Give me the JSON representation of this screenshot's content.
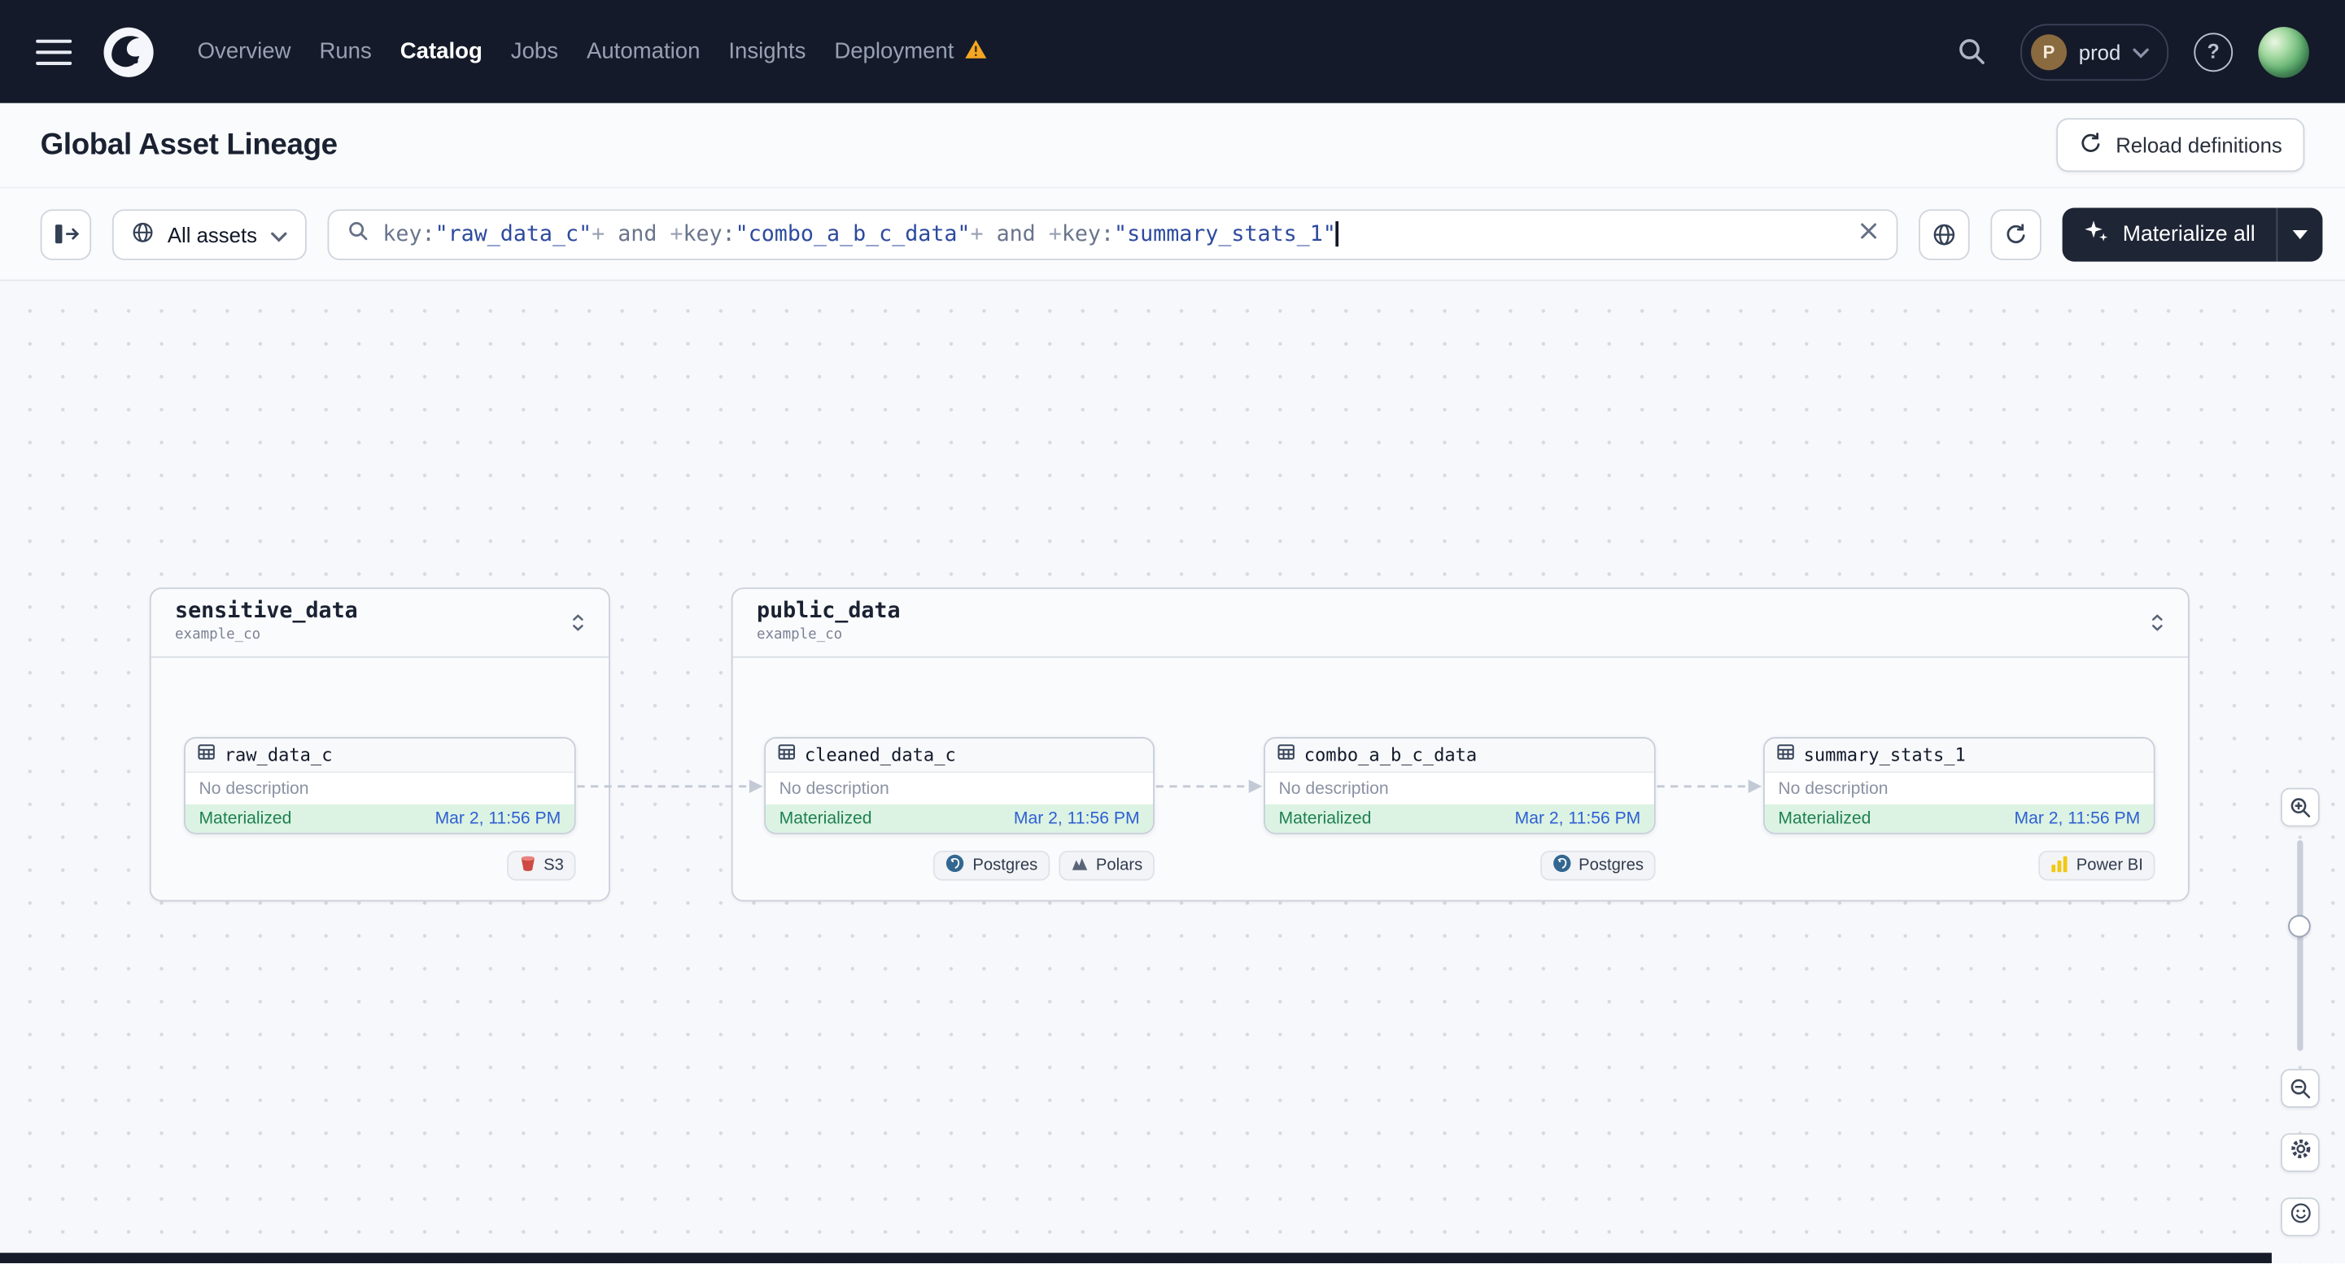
{
  "nav": {
    "items": [
      {
        "label": "Overview",
        "active": false
      },
      {
        "label": "Runs",
        "active": false
      },
      {
        "label": "Catalog",
        "active": true
      },
      {
        "label": "Jobs",
        "active": false
      },
      {
        "label": "Automation",
        "active": false
      },
      {
        "label": "Insights",
        "active": false
      },
      {
        "label": "Deployment",
        "active": false,
        "warning": true
      }
    ],
    "deployment_switcher": {
      "initial": "P",
      "label": "prod"
    },
    "help_glyph": "?"
  },
  "header": {
    "title": "Global Asset Lineage",
    "reload_button_label": "Reload definitions"
  },
  "toolbar": {
    "asset_filter_label": "All assets",
    "materialize_button_label": "Materialize all",
    "query_segments": [
      {
        "text": "key:",
        "type": "key"
      },
      {
        "text": "\"raw_data_c\"",
        "type": "value"
      },
      {
        "text": "+",
        "type": "plus"
      },
      {
        "text": " and ",
        "type": "keyword"
      },
      {
        "text": "+",
        "type": "plus"
      },
      {
        "text": "key:",
        "type": "key"
      },
      {
        "text": "\"combo_a_b_c_data\"",
        "type": "value"
      },
      {
        "text": "+",
        "type": "plus"
      },
      {
        "text": " and ",
        "type": "keyword"
      },
      {
        "text": "+",
        "type": "plus"
      },
      {
        "text": "key:",
        "type": "key"
      },
      {
        "text": "\"summary_stats_1\"",
        "type": "value"
      }
    ]
  },
  "graph": {
    "groups": [
      {
        "name": "sensitive_data",
        "org": "example_co",
        "assets": [
          {
            "name": "raw_data_c",
            "description": "No description",
            "status": "Materialized",
            "timestamp": "Mar 2, 11:56 PM",
            "tags": [
              {
                "label": "S3",
                "icon": "s3-icon"
              }
            ]
          }
        ]
      },
      {
        "name": "public_data",
        "org": "example_co",
        "assets": [
          {
            "name": "cleaned_data_c",
            "description": "No description",
            "status": "Materialized",
            "timestamp": "Mar 2, 11:56 PM",
            "tags": [
              {
                "label": "Postgres",
                "icon": "postgres-icon"
              },
              {
                "label": "Polars",
                "icon": "polars-icon"
              }
            ]
          },
          {
            "name": "combo_a_b_c_data",
            "description": "No description",
            "status": "Materialized",
            "timestamp": "Mar 2, 11:56 PM",
            "tags": [
              {
                "label": "Postgres",
                "icon": "postgres-icon"
              }
            ]
          },
          {
            "name": "summary_stats_1",
            "description": "No description",
            "status": "Materialized",
            "timestamp": "Mar 2, 11:56 PM",
            "tags": [
              {
                "label": "Power BI",
                "icon": "powerbi-icon"
              }
            ]
          }
        ]
      }
    ]
  },
  "colors": {
    "nav_bg": "#141A29",
    "materialize_bg": "#1E2535",
    "status_green_bg": "#DCF3E3",
    "status_green_text": "#1E8151",
    "timestamp_blue": "#2E5FD3",
    "warning_orange": "#F5A623",
    "query_value_blue": "#2D4A9E"
  }
}
